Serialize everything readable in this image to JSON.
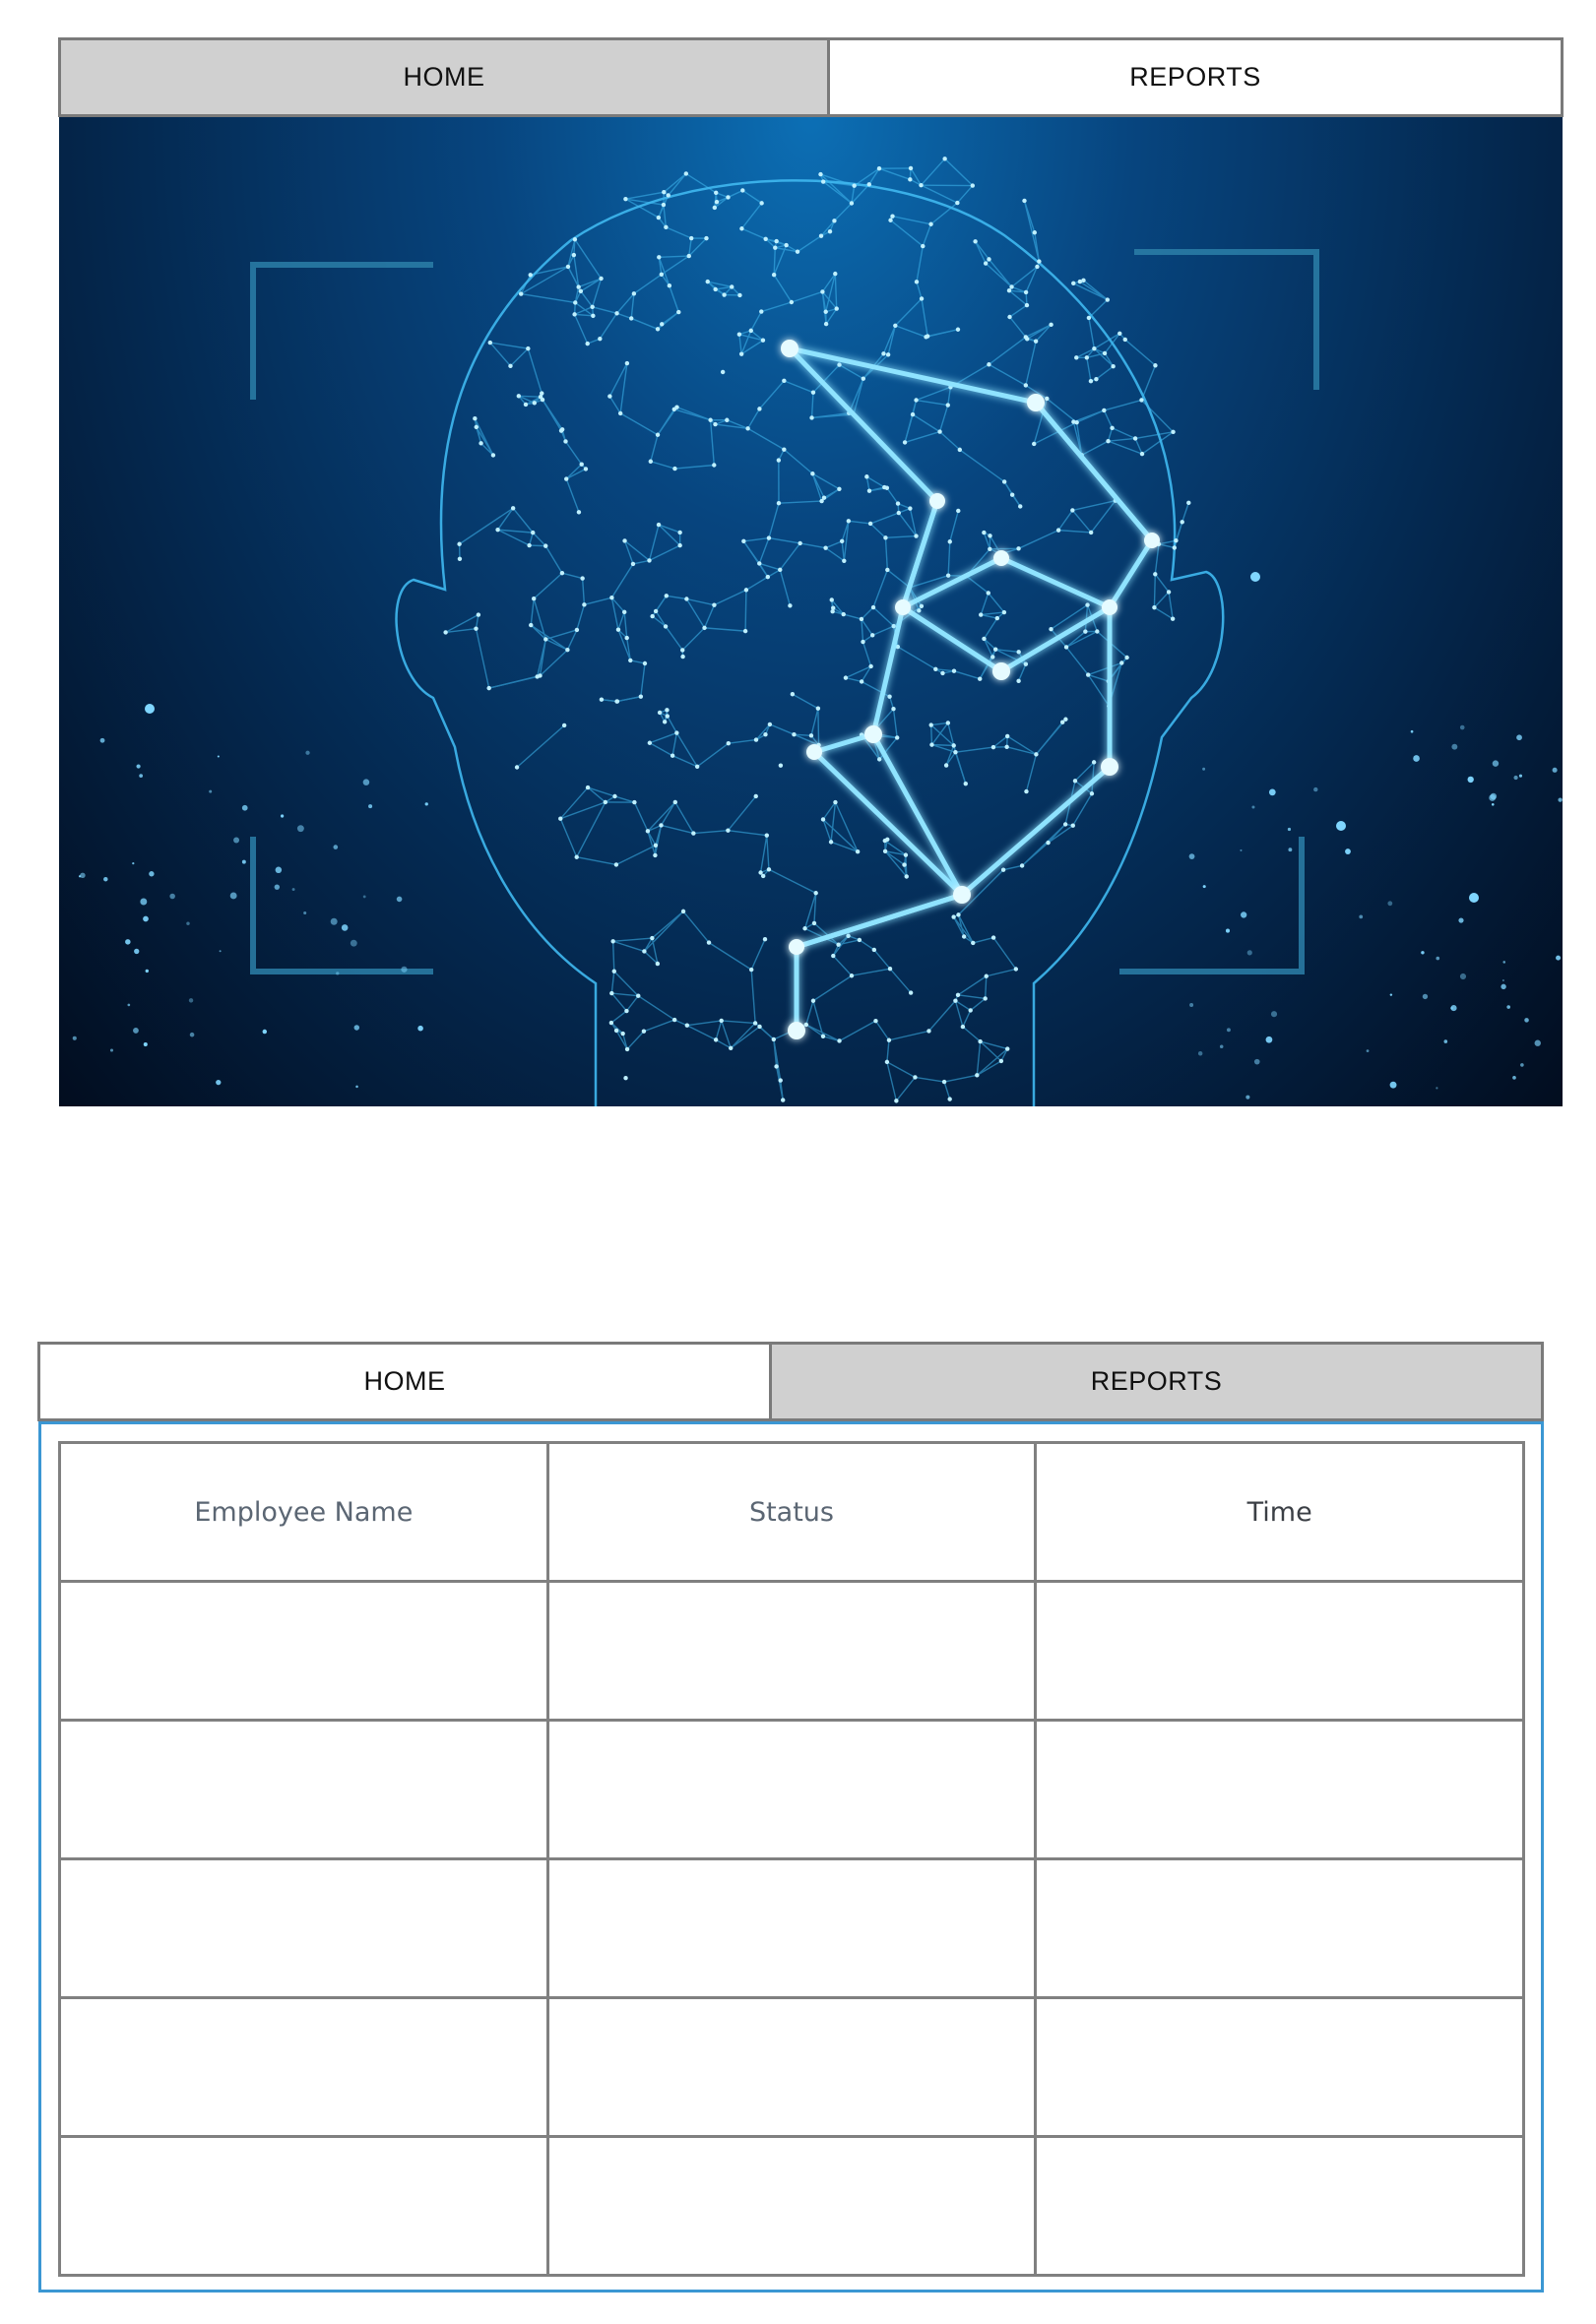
{
  "nav_top": {
    "home_label": "HOME",
    "reports_label": "REPORTS",
    "active_tab": "home"
  },
  "hero_image": {
    "description_icon": "face-recognition-mesh-image",
    "colors": {
      "background_top": "#0c6fb5",
      "background_bottom": "#020d1f",
      "mesh": "#3fb8f0",
      "node_glow": "#bff0ff",
      "frame_corner": "#2b7fa8"
    }
  },
  "nav_bottom": {
    "home_label": "HOME",
    "reports_label": "REPORTS",
    "active_tab": "reports"
  },
  "report_table": {
    "columns": [
      "Employee Name",
      "Status",
      "Time"
    ],
    "rows": [
      [
        "",
        "",
        ""
      ],
      [
        "",
        "",
        ""
      ],
      [
        "",
        "",
        ""
      ],
      [
        "",
        "",
        ""
      ],
      [
        "",
        "",
        ""
      ]
    ]
  },
  "colors": {
    "tab_active_bg": "#d0d0d0",
    "tab_inactive_bg": "#ffffff",
    "tab_border": "#7a7a7a",
    "panel_border": "#3b97d3",
    "table_border": "#808080",
    "header_text": "#5b6673"
  }
}
